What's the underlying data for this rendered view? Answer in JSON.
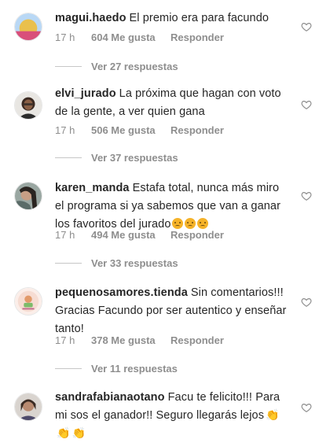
{
  "comments": [
    {
      "username": "magui.haedo",
      "text": "El premio era para facundo",
      "time": "17 h",
      "likes": "604 Me gusta",
      "reply": "Responder",
      "replies": "Ver 27 respuestas"
    },
    {
      "username": "elvi_jurado",
      "text": "La próxima que hagan con voto de la gente, a ver quien gana",
      "time": "17 h",
      "likes": "506 Me gusta",
      "reply": "Responder",
      "replies": "Ver 37 respuestas"
    },
    {
      "username": "karen_manda",
      "text": "Estafa total, nunca más miro el programa si ya sabemos que van a ganar los favoritos del jurado",
      "time": "17 h",
      "likes": "494 Me gusta",
      "reply": "Responder",
      "replies": "Ver 33 respuestas"
    },
    {
      "username": "pequenosamores.tienda",
      "text": "Sin comentarios!!! Gracias Facundo por ser autentico y enseñar tanto!",
      "time": "17 h",
      "likes": "378 Me gusta",
      "reply": "Responder",
      "replies": "Ver 11 respuestas"
    },
    {
      "username": "sandrafabianaotano",
      "text": "Facu te felicito!!! Para mi sos el ganador!! Seguro llegarás lejos",
      "emoji": "👏"
    }
  ],
  "colors": {
    "text": "#262626",
    "meta": "#8e8e8e",
    "emoji": "#f5b32a"
  }
}
